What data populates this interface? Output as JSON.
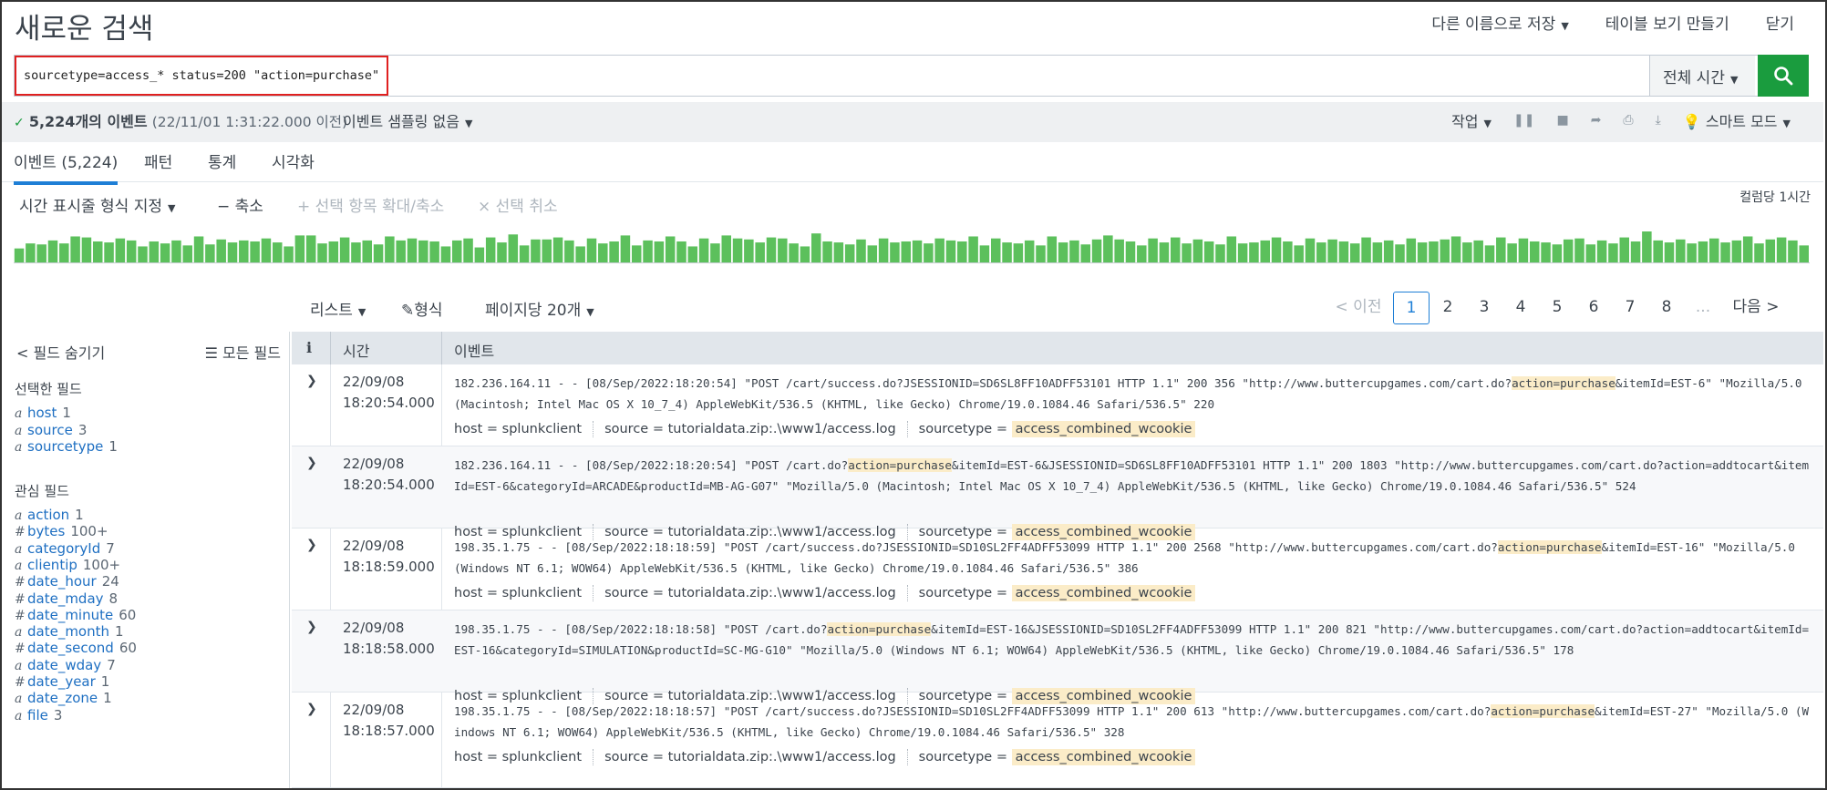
{
  "header": {
    "title": "새로운 검색",
    "save_as": "다른 이름으로 저장",
    "create_table_view": "테이블 보기 만들기",
    "close": "닫기"
  },
  "search": {
    "query": "sourcetype=access_* status=200 \"action=purchase\"",
    "time_range": "전체 시간"
  },
  "status": {
    "check": "✓",
    "count": "5,224개의 이벤트",
    "timestamp": "(22/11/01 1:31:22.000 이전)",
    "sampling": "이벤트 샘플링 없음",
    "job": "작업",
    "mode": "스마트 모드"
  },
  "tabs": [
    {
      "label": "이벤트 (5,224)",
      "active": true
    },
    {
      "label": "패턴"
    },
    {
      "label": "통계"
    },
    {
      "label": "시각화"
    }
  ],
  "timeline": {
    "format": "시간 표시줄 형식 지정",
    "zoom_out": "− 축소",
    "zoom_selection": "+ 선택 항목 확대/축소",
    "deselect": "× 선택 취소",
    "scale": "컬럼당 1시간",
    "counts": [
      14,
      19,
      18,
      22,
      19,
      26,
      25,
      21,
      20,
      24,
      22,
      16,
      21,
      19,
      22,
      17,
      26,
      18,
      23,
      20,
      22,
      21,
      24,
      20,
      16,
      27,
      27,
      19,
      21,
      25,
      20,
      22,
      18,
      26,
      22,
      24,
      22,
      21,
      16,
      22,
      24,
      15,
      25,
      20,
      28,
      17,
      23,
      23,
      25,
      22,
      16,
      24,
      19,
      21,
      27,
      17,
      22,
      21,
      26,
      21,
      16,
      24,
      19,
      27,
      24,
      23,
      20,
      25,
      24,
      19,
      16,
      29,
      21,
      20,
      18,
      23,
      17,
      24,
      20,
      21,
      22,
      19,
      24,
      22,
      21,
      26,
      17,
      24,
      20,
      19,
      22,
      17,
      26,
      20,
      22,
      18,
      23,
      27,
      23,
      21,
      17,
      24,
      20,
      25,
      19,
      23,
      21,
      18,
      26,
      19,
      20,
      22,
      25,
      21,
      17,
      24,
      20,
      23,
      21,
      19,
      25,
      20,
      22,
      18,
      24,
      20,
      21,
      23,
      26,
      20,
      22,
      17,
      25,
      19,
      24,
      21,
      20,
      18,
      23,
      24,
      18,
      22,
      19,
      25,
      21,
      31,
      22,
      20,
      23,
      19,
      21,
      24,
      20,
      22,
      26,
      19,
      23,
      25,
      22,
      17
    ]
  },
  "results_toolbar": {
    "list": "리스트",
    "format": "형식",
    "per_page": "페이지당 20개",
    "prev": "< 이전",
    "pages": [
      "1",
      "2",
      "3",
      "4",
      "5",
      "6",
      "7",
      "8"
    ],
    "ellipsis": "...",
    "next": "다음 >"
  },
  "sidebar": {
    "hide_fields": "< 필드 숨기기",
    "all_fields": "모든 필드",
    "selected_heading": "선택한 필드",
    "selected": [
      {
        "type": "a",
        "name": "host",
        "count": "1"
      },
      {
        "type": "a",
        "name": "source",
        "count": "3"
      },
      {
        "type": "a",
        "name": "sourcetype",
        "count": "1"
      }
    ],
    "interesting_heading": "관심 필드",
    "interesting": [
      {
        "type": "a",
        "name": "action",
        "count": "1"
      },
      {
        "type": "#",
        "name": "bytes",
        "count": "100+"
      },
      {
        "type": "a",
        "name": "categoryId",
        "count": "7"
      },
      {
        "type": "a",
        "name": "clientip",
        "count": "100+"
      },
      {
        "type": "#",
        "name": "date_hour",
        "count": "24"
      },
      {
        "type": "#",
        "name": "date_mday",
        "count": "8"
      },
      {
        "type": "#",
        "name": "date_minute",
        "count": "60"
      },
      {
        "type": "a",
        "name": "date_month",
        "count": "1"
      },
      {
        "type": "#",
        "name": "date_second",
        "count": "60"
      },
      {
        "type": "a",
        "name": "date_wday",
        "count": "7"
      },
      {
        "type": "#",
        "name": "date_year",
        "count": "1"
      },
      {
        "type": "a",
        "name": "date_zone",
        "count": "1"
      },
      {
        "type": "a",
        "name": "file",
        "count": "3"
      }
    ]
  },
  "table": {
    "col_info": "i",
    "col_time": "시간",
    "col_event": "이벤트",
    "events": [
      {
        "date": "22/09/08",
        "time": "18:20:54.000",
        "pre": "182.236.164.11 - - [08/Sep/2022:18:20:54] \"POST /cart/success.do?JSESSIONID=SD6SL8FF10ADFF53101 HTTP 1.1\" 200 356 \"http://www.buttercupgames.com/cart.do?",
        "hl": "action=purchase",
        "post": "&itemId=EST-6\" \"Mozilla/5.0 (Macintosh; Intel Mac OS X 10_7_4) AppleWebKit/536.5 (KHTML, like Gecko) Chrome/19.0.1084.46 Safari/536.5\" 220",
        "host": "host = splunkclient",
        "source": "source = tutorialdata.zip:.\\www1/access.log",
        "st_label": "sourcetype =",
        "st_value": "access_combined_wcookie"
      },
      {
        "date": "22/09/08",
        "time": "18:20:54.000",
        "pre": "182.236.164.11 - - [08/Sep/2022:18:20:54] \"POST /cart.do?",
        "hl": "action=purchase",
        "post": "&itemId=EST-6&JSESSIONID=SD6SL8FF10ADFF53101 HTTP 1.1\" 200 1803 \"http://www.buttercupgames.com/cart.do?action=addtocart&itemId=EST-6&categoryId=ARCADE&productId=MB-AG-G07\" \"Mozilla/5.0 (Macintosh; Intel Mac OS X 10_7_4) AppleWebKit/536.5 (KHTML, like Gecko) Chrome/19.0.1084.46 Safari/536.5\" 524",
        "host": "host = splunkclient",
        "source": "source = tutorialdata.zip:.\\www1/access.log",
        "st_label": "sourcetype =",
        "st_value": "access_combined_wcookie"
      },
      {
        "date": "22/09/08",
        "time": "18:18:59.000",
        "pre": "198.35.1.75 - - [08/Sep/2022:18:18:59] \"POST /cart/success.do?JSESSIONID=SD10SL2FF4ADFF53099 HTTP 1.1\" 200 2568 \"http://www.buttercupgames.com/cart.do?",
        "hl": "action=purchase",
        "post": "&itemId=EST-16\" \"Mozilla/5.0 (Windows NT 6.1; WOW64) AppleWebKit/536.5 (KHTML, like Gecko) Chrome/19.0.1084.46 Safari/536.5\" 386",
        "host": "host = splunkclient",
        "source": "source = tutorialdata.zip:.\\www1/access.log",
        "st_label": "sourcetype =",
        "st_value": "access_combined_wcookie"
      },
      {
        "date": "22/09/08",
        "time": "18:18:58.000",
        "pre": "198.35.1.75 - - [08/Sep/2022:18:18:58] \"POST /cart.do?",
        "hl": "action=purchase",
        "post": "&itemId=EST-16&JSESSIONID=SD10SL2FF4ADFF53099 HTTP 1.1\" 200 821 \"http://www.buttercupgames.com/cart.do?action=addtocart&itemId=EST-16&categoryId=SIMULATION&productId=SC-MG-G10\" \"Mozilla/5.0 (Windows NT 6.1; WOW64) AppleWebKit/536.5 (KHTML, like Gecko) Chrome/19.0.1084.46 Safari/536.5\" 178",
        "host": "host = splunkclient",
        "source": "source = tutorialdata.zip:.\\www1/access.log",
        "st_label": "sourcetype =",
        "st_value": "access_combined_wcookie"
      },
      {
        "date": "22/09/08",
        "time": "18:18:57.000",
        "pre": "198.35.1.75 - - [08/Sep/2022:18:18:57] \"POST /cart/success.do?JSESSIONID=SD10SL2FF4ADFF53099 HTTP 1.1\" 200 613 \"http://www.buttercupgames.com/cart.do?",
        "hl": "action=purchase",
        "post": "&itemId=EST-27\" \"Mozilla/5.0 (Windows NT 6.1; WOW64) AppleWebKit/536.5 (KHTML, like Gecko) Chrome/19.0.1084.46 Safari/536.5\" 328",
        "host": "host = splunkclient",
        "source": "source = tutorialdata.zip:.\\www1/access.log",
        "st_label": "sourcetype =",
        "st_value": "access_combined_wcookie"
      }
    ]
  }
}
